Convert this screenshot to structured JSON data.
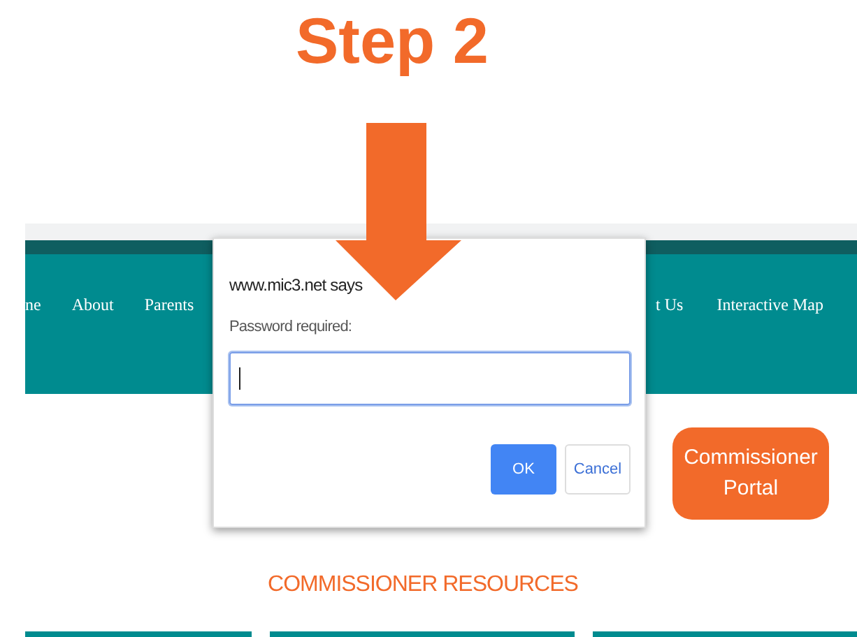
{
  "heading": "Step 2",
  "site": {
    "nav_items": [
      {
        "label": "ne"
      },
      {
        "label": "About"
      },
      {
        "label": "Parents"
      },
      {
        "label": "t Us"
      },
      {
        "label": "Interactive Map"
      }
    ],
    "portal_button": "Commissioner Portal",
    "section_title": "COMMISSIONER RESOURCES"
  },
  "dialog": {
    "origin": "www.mic3.net says",
    "message": "Password required:",
    "input": {
      "focused": true
    },
    "buttons": [
      {
        "label": "OK",
        "kind": "primary"
      },
      {
        "label": "Cancel",
        "kind": "secondary"
      }
    ]
  }
}
